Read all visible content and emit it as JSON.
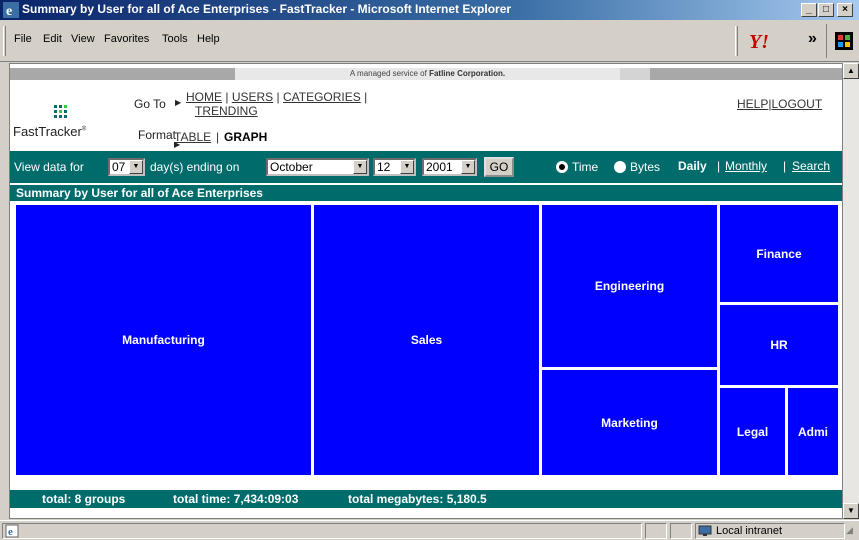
{
  "window": {
    "title": "Summary by User for all of Ace Enterprises - FastTracker - Microsoft Internet Explorer",
    "min": "_",
    "max": "□",
    "close": "×"
  },
  "menu": [
    "File",
    "Edit",
    "View",
    "Favorites",
    "Tools",
    "Help"
  ],
  "toolbar": {
    "chevron": "»"
  },
  "banner": {
    "prefix": "A managed service of ",
    "company": "Fatline Corporation."
  },
  "nav": {
    "logo": "FastTracker",
    "logo_tm": "®",
    "goto_label": "Go To",
    "links": [
      "HOME",
      "USERS",
      "CATEGORIES",
      "TRENDING"
    ],
    "format_label": "Format",
    "format_table": "TABLE",
    "format_graph": "GRAPH",
    "help": "HELP",
    "logout": "LOGOUT",
    "separator": "|"
  },
  "controls": {
    "view_data_for": "View data for",
    "days_value": "07",
    "days_ending_on": "day(s) ending on",
    "month_value": "October",
    "day_value": "12",
    "year_value": "2001",
    "go": "GO",
    "radio_time": "Time",
    "radio_bytes": "Bytes",
    "selected_metric": "Time",
    "daily": "Daily",
    "monthly": "Monthly",
    "search": "Search"
  },
  "section_title": "Summary by User for all of Ace Enterprises",
  "treemap": {
    "color": "#0000ff",
    "groups": [
      "Manufacturing",
      "Sales",
      "Engineering",
      "Marketing",
      "Finance",
      "HR",
      "Legal",
      "Admi"
    ]
  },
  "footer": {
    "total_groups": "total: 8 groups",
    "total_time": "total time: 7,434:09:03",
    "total_mb": "total megabytes: 5,180.5"
  },
  "status": {
    "zone": "Local intranet"
  },
  "colors": {
    "accent": "#006b6b",
    "treemap": "#0000ff",
    "titlebar": "#0a246a"
  }
}
